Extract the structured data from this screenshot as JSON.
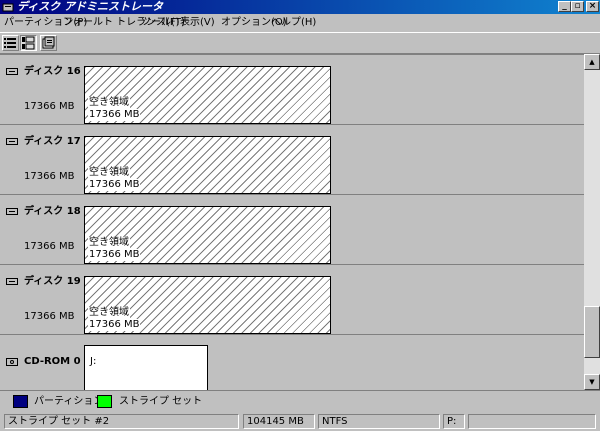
{
  "window": {
    "title": "ディスク アドミニストレータ"
  },
  "menu": [
    "パーティション(P)",
    "フォールト トレランス(F)",
    "ツール(T)",
    "表示(V)",
    "オプション(O)",
    "ヘルプ(H)"
  ],
  "disks": [
    {
      "name": "ディスク 16",
      "size": "17366 MB",
      "partition_label": "空き領域",
      "partition_size": "17366 MB"
    },
    {
      "name": "ディスク 17",
      "size": "17366 MB",
      "partition_label": "空き領域",
      "partition_size": "17366 MB"
    },
    {
      "name": "ディスク 18",
      "size": "17366 MB",
      "partition_label": "空き領域",
      "partition_size": "17366 MB"
    },
    {
      "name": "ディスク 19",
      "size": "17366 MB",
      "partition_label": "空き領域",
      "partition_size": "17366 MB"
    }
  ],
  "cdrom": {
    "name": "CD-ROM 0",
    "drive": "J:"
  },
  "legend": [
    {
      "label": "パーティション",
      "color": "#000080"
    },
    {
      "label": "ストライプ セット",
      "color": "#00ff00"
    }
  ],
  "status": {
    "selection": "ストライプ セット #2",
    "size": "104145 MB",
    "filesystem": "NTFS",
    "drive": "P:",
    "label": ""
  }
}
